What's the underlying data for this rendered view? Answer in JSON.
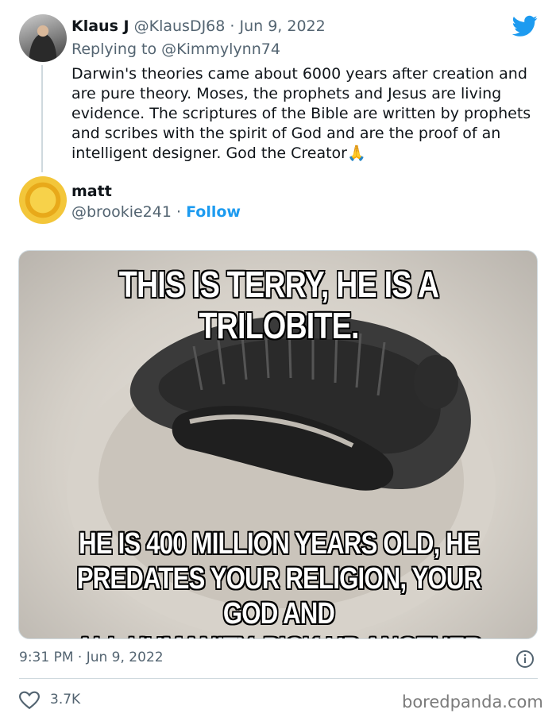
{
  "reply_tweet": {
    "author_name": "Klaus J",
    "author_handle": "@KlausDJ68",
    "separator": " · ",
    "date": "Jun 9, 2022",
    "replying_prefix": "Replying to ",
    "replying_to": "@Kimmylynn74",
    "body": "Darwin's theories came about 6000 years after creation and are pure theory.  Moses, the prophets and Jesus are living evidence.  The scriptures of the Bible are written by prophets and scribes with the spirit of God and are the proof of an intelligent designer.  God the Creator🙏"
  },
  "main_tweet": {
    "author_name": "matt",
    "author_handle": "@brookie241",
    "separator": " · ",
    "follow_label": "Follow",
    "meme": {
      "top_line_1": "This is Terry, he is a",
      "top_line_2": "trilobite.",
      "bottom_line_1": "He is 400 million years old, he",
      "bottom_line_2": "predates your religion, your god and",
      "bottom_line_3": "all humanity. Pick up another book."
    },
    "time": "9:31 PM",
    "date_separator": " · ",
    "date": "Jun 9, 2022",
    "like_count": "3.7K"
  },
  "watermark": "boredpanda.com",
  "icons": {
    "brand": "twitter-bird-icon",
    "info": "info-icon",
    "like": "heart-icon"
  },
  "colors": {
    "accent": "#1d9bf0",
    "muted": "#536471",
    "text": "#0f1419"
  }
}
